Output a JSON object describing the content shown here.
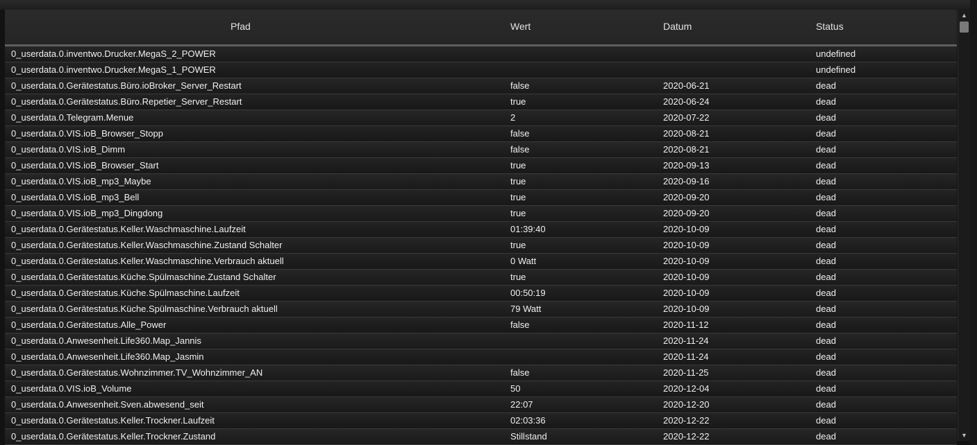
{
  "table": {
    "headers": {
      "path": "Pfad",
      "value": "Wert",
      "date": "Datum",
      "status": "Status"
    },
    "rows": [
      {
        "path": "0_userdata.0.inventwo.Drucker.MegaS_2_POWER",
        "value": "",
        "date": "",
        "status": "undefined"
      },
      {
        "path": "0_userdata.0.inventwo.Drucker.MegaS_1_POWER",
        "value": "",
        "date": "",
        "status": "undefined"
      },
      {
        "path": "0_userdata.0.Gerätestatus.Büro.ioBroker_Server_Restart",
        "value": "false",
        "date": "2020-06-21",
        "status": "dead"
      },
      {
        "path": "0_userdata.0.Gerätestatus.Büro.Repetier_Server_Restart",
        "value": "true",
        "date": "2020-06-24",
        "status": "dead"
      },
      {
        "path": "0_userdata.0.Telegram.Menue",
        "value": "2",
        "date": "2020-07-22",
        "status": "dead"
      },
      {
        "path": "0_userdata.0.VIS.ioB_Browser_Stopp",
        "value": "false",
        "date": "2020-08-21",
        "status": "dead"
      },
      {
        "path": "0_userdata.0.VIS.ioB_Dimm",
        "value": "false",
        "date": "2020-08-21",
        "status": "dead"
      },
      {
        "path": "0_userdata.0.VIS.ioB_Browser_Start",
        "value": "true",
        "date": "2020-09-13",
        "status": "dead"
      },
      {
        "path": "0_userdata.0.VIS.ioB_mp3_Maybe",
        "value": "true",
        "date": "2020-09-16",
        "status": "dead"
      },
      {
        "path": "0_userdata.0.VIS.ioB_mp3_Bell",
        "value": "true",
        "date": "2020-09-20",
        "status": "dead"
      },
      {
        "path": "0_userdata.0.VIS.ioB_mp3_Dingdong",
        "value": "true",
        "date": "2020-09-20",
        "status": "dead"
      },
      {
        "path": "0_userdata.0.Gerätestatus.Keller.Waschmaschine.Laufzeit",
        "value": "01:39:40",
        "date": "2020-10-09",
        "status": "dead"
      },
      {
        "path": "0_userdata.0.Gerätestatus.Keller.Waschmaschine.Zustand Schalter",
        "value": "true",
        "date": "2020-10-09",
        "status": "dead"
      },
      {
        "path": "0_userdata.0.Gerätestatus.Keller.Waschmaschine.Verbrauch aktuell",
        "value": "0 Watt",
        "date": "2020-10-09",
        "status": "dead"
      },
      {
        "path": "0_userdata.0.Gerätestatus.Küche.Spülmaschine.Zustand Schalter",
        "value": "true",
        "date": "2020-10-09",
        "status": "dead"
      },
      {
        "path": "0_userdata.0.Gerätestatus.Küche.Spülmaschine.Laufzeit",
        "value": "00:50:19",
        "date": "2020-10-09",
        "status": "dead"
      },
      {
        "path": "0_userdata.0.Gerätestatus.Küche.Spülmaschine.Verbrauch aktuell",
        "value": "79 Watt",
        "date": "2020-10-09",
        "status": "dead"
      },
      {
        "path": "0_userdata.0.Gerätestatus.Alle_Power",
        "value": "false",
        "date": "2020-11-12",
        "status": "dead"
      },
      {
        "path": "0_userdata.0.Anwesenheit.Life360.Map_Jannis",
        "value": "",
        "date": "2020-11-24",
        "status": "dead"
      },
      {
        "path": "0_userdata.0.Anwesenheit.Life360.Map_Jasmin",
        "value": "",
        "date": "2020-11-24",
        "status": "dead"
      },
      {
        "path": "0_userdata.0.Gerätestatus.Wohnzimmer.TV_Wohnzimmer_AN",
        "value": "false",
        "date": "2020-11-25",
        "status": "dead"
      },
      {
        "path": "0_userdata.0.VIS.ioB_Volume",
        "value": "50",
        "date": "2020-12-04",
        "status": "dead"
      },
      {
        "path": "0_userdata.0.Anwesenheit.Sven.abwesend_seit",
        "value": "22:07",
        "date": "2020-12-20",
        "status": "dead"
      },
      {
        "path": "0_userdata.0.Gerätestatus.Keller.Trockner.Laufzeit",
        "value": "02:03:36",
        "date": "2020-12-22",
        "status": "dead"
      },
      {
        "path": "0_userdata.0.Gerätestatus.Keller.Trockner.Zustand",
        "value": "Stillstand",
        "date": "2020-12-22",
        "status": "dead"
      }
    ]
  },
  "scrollbar": {
    "up_icon": "chevron-up-icon",
    "down_icon": "chevron-down-icon",
    "up_glyph": "▲",
    "down_glyph": "▼"
  }
}
